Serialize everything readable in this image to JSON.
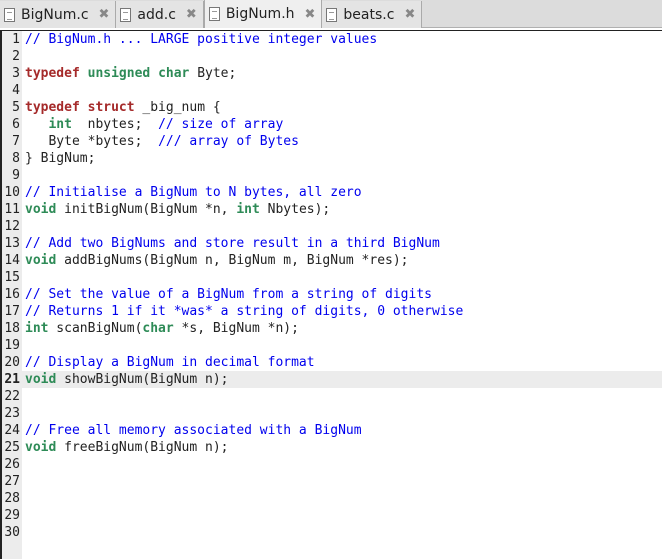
{
  "tabs": [
    {
      "label": "BigNum.c",
      "active": false
    },
    {
      "label": "add.c",
      "active": false
    },
    {
      "label": "BigNum.h",
      "active": true
    },
    {
      "label": "beats.c",
      "active": false
    }
  ],
  "close_glyph": "✖",
  "current_line": 21,
  "lines": [
    [
      [
        "// BigNum.h ... LARGE positive integer values",
        "cm"
      ]
    ],
    [],
    [
      [
        "typedef",
        "kw"
      ],
      [
        " unsigned char",
        "ty"
      ],
      [
        " Byte;",
        ""
      ]
    ],
    [],
    [
      [
        "typedef struct",
        "kw"
      ],
      [
        " _big_num {",
        ""
      ]
    ],
    [
      [
        "   ",
        ""
      ],
      [
        "int",
        "ty"
      ],
      [
        "  nbytes;  ",
        ""
      ],
      [
        "// size of array",
        "cm"
      ]
    ],
    [
      [
        "   Byte *bytes;  ",
        ""
      ],
      [
        "/// array of Bytes",
        "cm"
      ]
    ],
    [
      [
        "} BigNum;",
        ""
      ]
    ],
    [],
    [
      [
        "// Initialise a BigNum to N bytes, all zero",
        "cm"
      ]
    ],
    [
      [
        "void",
        "ty"
      ],
      [
        " initBigNum(BigNum *n, ",
        ""
      ],
      [
        "int",
        "ty"
      ],
      [
        " Nbytes);",
        ""
      ]
    ],
    [],
    [
      [
        "// Add two BigNums and store result in a third BigNum",
        "cm"
      ]
    ],
    [
      [
        "void",
        "ty"
      ],
      [
        " addBigNums(BigNum n, BigNum m, BigNum *res);",
        ""
      ]
    ],
    [],
    [
      [
        "// Set the value of a BigNum from a string of digits",
        "cm"
      ]
    ],
    [
      [
        "// Returns 1 if it *was* a string of digits, 0 otherwise",
        "cm"
      ]
    ],
    [
      [
        "int",
        "ty"
      ],
      [
        " scanBigNum(",
        ""
      ],
      [
        "char",
        "ty"
      ],
      [
        " *s, BigNum *n);",
        ""
      ]
    ],
    [],
    [
      [
        "// Display a BigNum in decimal format",
        "cm"
      ]
    ],
    [
      [
        "void",
        "ty"
      ],
      [
        " showBigNum(BigNum n);",
        ""
      ]
    ],
    [],
    [],
    [
      [
        "// Free all memory associated with a BigNum",
        "cm"
      ]
    ],
    [
      [
        "void",
        "ty"
      ],
      [
        " freeBigNum(BigNum n);",
        ""
      ]
    ],
    [],
    [],
    [],
    [],
    []
  ]
}
